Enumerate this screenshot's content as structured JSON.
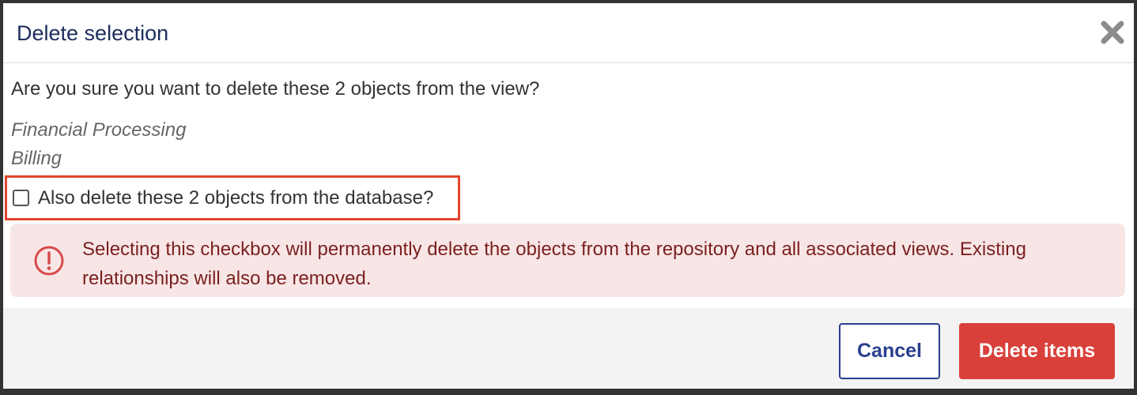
{
  "dialog": {
    "title": "Delete selection",
    "question": "Are you sure you want to delete these 2 objects from the view?",
    "objects": [
      "Financial Processing",
      "Billing"
    ],
    "checkbox": {
      "label": "Also delete these 2 objects from the database?",
      "checked": false
    },
    "alert": {
      "text": "Selecting this checkbox will permanently delete the objects from the repository and all associated views. Existing relationships will also be removed.",
      "icon": "exclamation-circle-icon"
    },
    "buttons": {
      "cancel_label": "Cancel",
      "delete_label": "Delete items"
    }
  },
  "colors": {
    "title": "#1c2d5c",
    "highlight_border": "#e0452e",
    "alert_background": "#f8e6e6",
    "alert_text": "#7b1f1f",
    "cancel_border": "#2a3f8f",
    "delete_background": "#d9403a"
  }
}
